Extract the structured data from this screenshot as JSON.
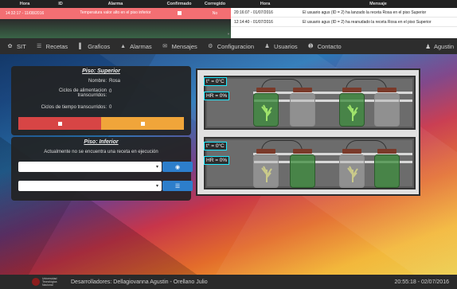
{
  "alarms": {
    "headers": [
      "Hora",
      "ID",
      "Alarma",
      "Confirmado",
      "Corregido"
    ],
    "rows": [
      {
        "hora": "14:32:17 - 11/08/2016",
        "id": "",
        "alarma": "Temperatura valor alto en el piso inferior",
        "confirmado": "",
        "corregido": "No"
      }
    ]
  },
  "messages": {
    "headers": [
      "Hora",
      "Mensaje"
    ],
    "rows": [
      {
        "hora": "20:16:07 - 01/07/2016",
        "mensaje": "El usuario agus (ID = 2) ha lanzado la receta Rosa en el piso Superior"
      },
      {
        "hora": "12:14:40 - 01/07/2016",
        "mensaje": "El usuario agus (ID = 2) ha reanudado la receta Rosa en el piso Superior"
      }
    ]
  },
  "nav": {
    "items": [
      {
        "label": "SIT",
        "icon": "leaf-icon"
      },
      {
        "label": "Recetas",
        "icon": "list-icon"
      },
      {
        "label": "Graficos",
        "icon": "bar-chart-icon"
      },
      {
        "label": "Alarmas",
        "icon": "bell-icon"
      },
      {
        "label": "Mensajes",
        "icon": "envelope-icon"
      },
      {
        "label": "Configuracion",
        "icon": "gear-icon"
      },
      {
        "label": "Usuarios",
        "icon": "user-icon"
      },
      {
        "label": "Contacto",
        "icon": "info-icon"
      }
    ],
    "user": "Agustin"
  },
  "piso_superior": {
    "title": "Piso: Superior",
    "nombre_label": "Nombre:",
    "nombre_value": "Rosa",
    "ciclos_alim_label": "Ciclos de alimentacion transcurridos:",
    "ciclos_alim_value": "0",
    "ciclos_tiempo_label": "Ciclos de tiempo transcurridos:",
    "ciclos_tiempo_value": "0"
  },
  "piso_inferior": {
    "title": "Piso: Inferior",
    "status": "Actualmente no se encuentra una receta en ejecución"
  },
  "chamber": {
    "top": {
      "temp": "t° = 0°C",
      "hr": "HR = 0%"
    },
    "bottom": {
      "temp": "t° = 0°C",
      "hr": "HR = 0%"
    }
  },
  "footer": {
    "logo_text": "Universidad Tecnológica Nacional",
    "devs": "Desarrolladores: Dellagiovanna Agustin - Orellano Julio",
    "clock": "20:55:18 - 02/07/2016"
  },
  "colors": {
    "alarm_row": "#f36f73",
    "accent_blue": "#2d7ecb",
    "readout_border": "#1de9ff"
  }
}
